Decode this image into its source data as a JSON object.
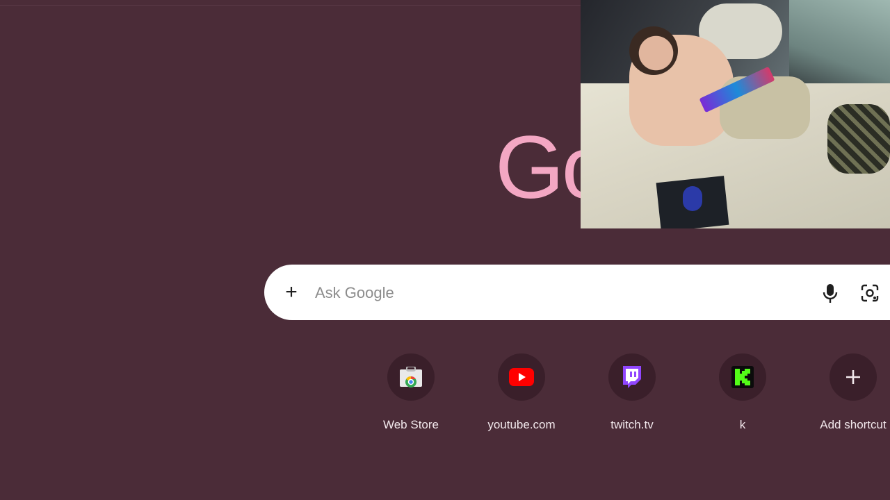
{
  "browser": {
    "logo_text": "Go"
  },
  "search": {
    "placeholder": "Ask Google",
    "add_icon": "plus-icon",
    "voice_icon": "microphone-icon",
    "lens_icon": "camera-lens-icon"
  },
  "shortcuts": [
    {
      "label": "Web Store",
      "icon": "chrome-web-store-icon"
    },
    {
      "label": "youtube.com",
      "icon": "youtube-icon"
    },
    {
      "label": "twitch.tv",
      "icon": "twitch-icon"
    },
    {
      "label": "k",
      "icon": "kick-icon"
    },
    {
      "label": "Add shortcut",
      "icon": "plus-icon"
    }
  ],
  "colors": {
    "background": "#4b2c38",
    "logo": "#f3a7c3",
    "tile": "#3a1f2a"
  }
}
